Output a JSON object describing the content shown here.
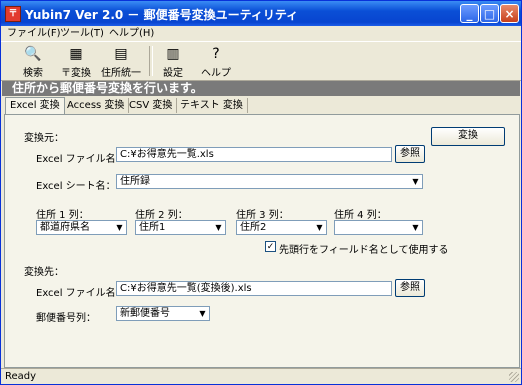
{
  "window": {
    "title": "Yubin7 Ver 2.0 － 郵便番号変換ユーティリティ"
  },
  "menu": {
    "items": [
      "ファイル(F)",
      "ツール(T)",
      "ヘルプ(H)"
    ]
  },
  "toolbar": {
    "buttons": [
      "検索",
      "〒変換",
      "住所統一",
      "設定",
      "ヘルプ"
    ]
  },
  "banner": {
    "text": "住所から郵便番号変換を行います。"
  },
  "tabs": [
    "Excel 変換",
    "Access 変換",
    "CSV 変換",
    "テキスト 変換"
  ],
  "source": {
    "section_label": "変換元：",
    "file_label": "Excel ファイル名：",
    "file_value": "C:¥お得意先一覧.xls",
    "browse_label": "参照",
    "sheet_label": "Excel シート名：",
    "sheet_value": "住所録",
    "columns": [
      {
        "label": "住所 1 列：",
        "value": "都道府県名"
      },
      {
        "label": "住所 2 列：",
        "value": "住所1"
      },
      {
        "label": "住所 3 列：",
        "value": "住所2"
      },
      {
        "label": "住所 4 列：",
        "value": ""
      }
    ],
    "header_checkbox_label": "先頭行をフィールド名として使用する",
    "header_checked": true
  },
  "dest": {
    "section_label": "変換先：",
    "file_label": "Excel ファイル名：",
    "file_value": "C:¥お得意先一覧(変換後).xls",
    "browse_label": "参照",
    "zip_label": "郵便番号列：",
    "zip_value": "新郵便番号"
  },
  "convert_button": "変換",
  "status": {
    "text": "Ready"
  }
}
